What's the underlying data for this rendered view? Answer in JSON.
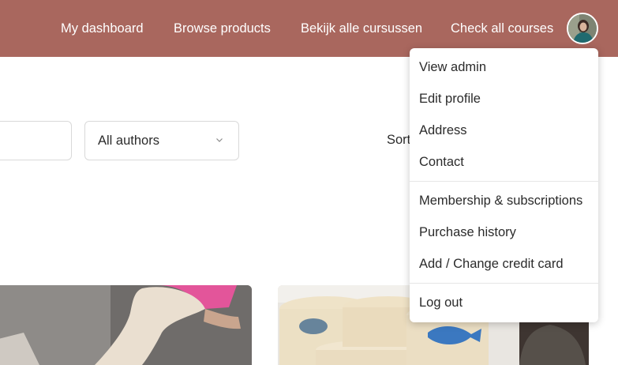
{
  "nav": {
    "links": [
      "My dashboard",
      "Browse products",
      "Bekijk alle cursussen",
      "Check all courses"
    ]
  },
  "header": {
    "background": "#a9675e"
  },
  "filters": {
    "authors_value": "All authors",
    "sort_label": "Sort"
  },
  "user_menu": {
    "group1": [
      "View admin",
      "Edit profile",
      "Address",
      "Contact"
    ],
    "group2": [
      "Membership & subscriptions",
      "Purchase history",
      "Add / Change credit card"
    ],
    "group3": [
      "Log out"
    ]
  }
}
